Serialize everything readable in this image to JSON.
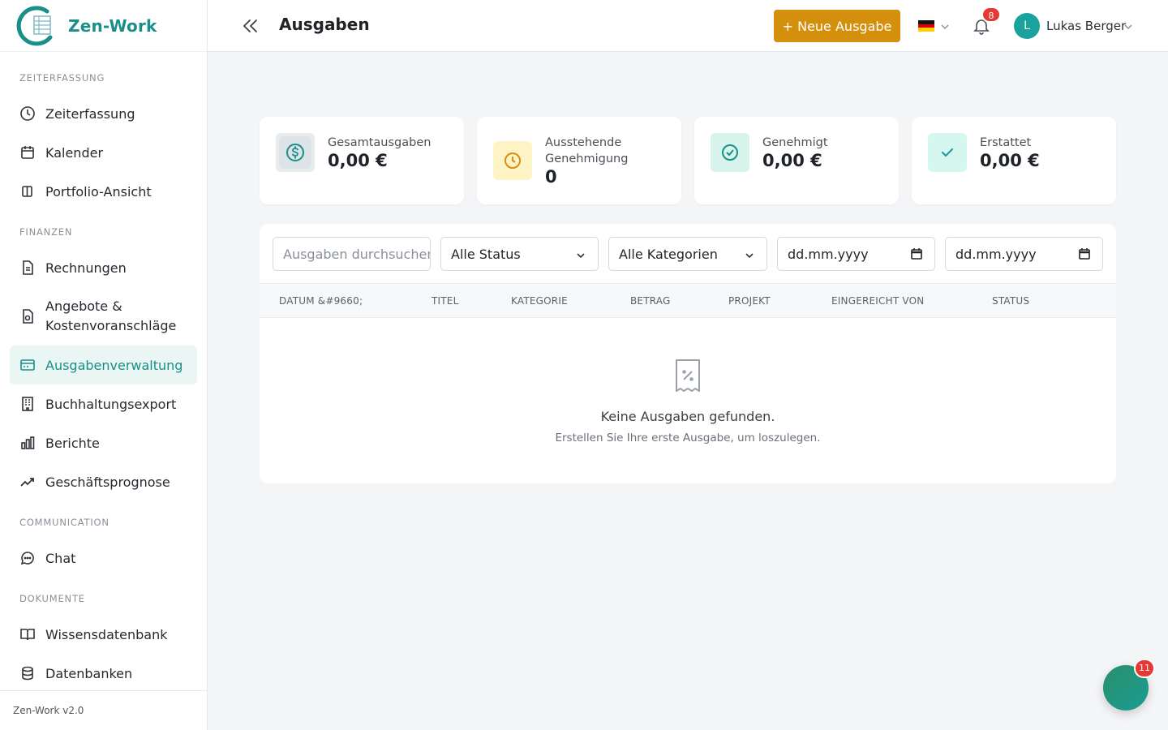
{
  "app": {
    "name": "Zen-Work",
    "version": "Zen-Work v2.0"
  },
  "sidebar": {
    "sections": [
      {
        "title": "ZEITERFASSUNG",
        "items": [
          {
            "label": "Zeiterfassung",
            "icon": "clock-icon"
          },
          {
            "label": "Kalender",
            "icon": "calendar-icon"
          },
          {
            "label": "Portfolio-Ansicht",
            "icon": "columns-icon"
          }
        ]
      },
      {
        "title": "FINANZEN",
        "items": [
          {
            "label": "Rechnungen",
            "icon": "document-icon"
          },
          {
            "label": "Angebote & Kostenvoranschläge",
            "icon": "quote-icon"
          },
          {
            "label": "Ausgabenverwaltung",
            "icon": "card-icon",
            "active": true
          },
          {
            "label": "Buchhaltungsexport",
            "icon": "building-icon"
          },
          {
            "label": "Berichte",
            "icon": "bar-chart-icon"
          },
          {
            "label": "Geschäftsprognose",
            "icon": "trend-icon"
          }
        ]
      },
      {
        "title": "COMMUNICATION",
        "items": [
          {
            "label": "Chat",
            "icon": "chat-icon"
          }
        ]
      },
      {
        "title": "DOKUMENTE",
        "items": [
          {
            "label": "Wissensdatenbank",
            "icon": "book-icon"
          },
          {
            "label": "Datenbanken",
            "icon": "database-icon"
          }
        ]
      }
    ]
  },
  "header": {
    "title": "Ausgaben",
    "new_button": "+ Neue Ausgabe",
    "notifications_count": "8",
    "user_initial": "L",
    "user_name": "Lukas Berger"
  },
  "stats": [
    {
      "label": "Gesamtausgaben",
      "value": "0,00 €",
      "icon": "dollar-icon",
      "color": "#e7ecef"
    },
    {
      "label": "Ausstehende Genehmigung",
      "value": "0",
      "icon": "clock-icon",
      "color": "#fdf3c4"
    },
    {
      "label": "Genehmigt",
      "value": "0,00 €",
      "icon": "check-circle-icon",
      "color": "#d6f4ec"
    },
    {
      "label": "Erstattet",
      "value": "0,00 €",
      "icon": "check-icon",
      "color": "#d6f7ef"
    }
  ],
  "filters": {
    "search_placeholder": "Ausgaben durchsuchen",
    "status_select": "Alle Status",
    "category_select": "Alle Kategorien",
    "date_from": "dd.mm.yyyy",
    "date_to": "dd.mm.yyyy"
  },
  "table": {
    "columns": [
      "DATUM &#9660;",
      "TITEL",
      "KATEGORIE",
      "BETRAG",
      "PROJEKT",
      "EINGEREICHT VON",
      "STATUS"
    ],
    "empty_title": "Keine Ausgaben gefunden.",
    "empty_subtitle": "Erstellen Sie Ihre erste Ausgabe, um loszulegen."
  },
  "chat_fab": {
    "badge": "11"
  },
  "colors": {
    "brand": "#1a8f8a",
    "accent": "#d4900c",
    "danger": "#e53935"
  }
}
